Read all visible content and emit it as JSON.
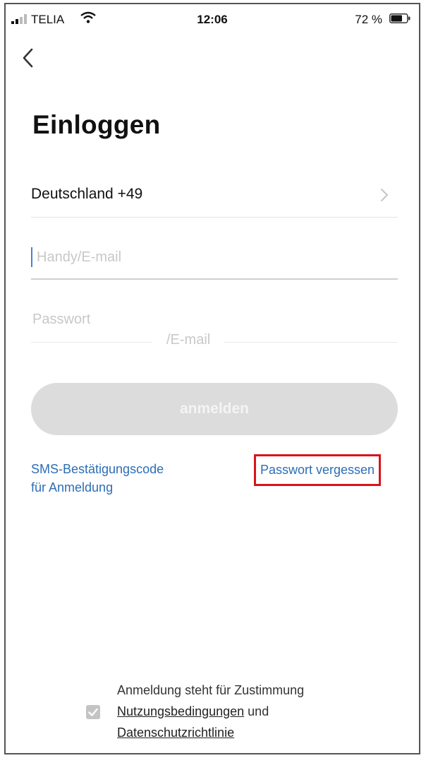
{
  "status_bar": {
    "carrier": "TELIA",
    "time": "12:06",
    "battery_percent": "72 %",
    "battery_level": 0.72
  },
  "nav": {
    "back_icon": "chevron-left-icon"
  },
  "page": {
    "title": "Einloggen"
  },
  "country": {
    "label": "Deutschland +49",
    "chevron_icon": "chevron-right-icon"
  },
  "form": {
    "user_placeholder": "Handy/E-mail",
    "user_value": "",
    "password_placeholder": "Passwort",
    "password_value": "",
    "overlay_text": "/E-mail"
  },
  "actions": {
    "login_label": "anmelden",
    "sms_line1": "SMS-Bestätigungscode",
    "sms_line2": "für Anmeldung",
    "forgot_label": "Passwort vergessen"
  },
  "agreement": {
    "text_line1": "Anmeldung steht für Zustimmung",
    "terms_link": "Nutzungsbedingungen",
    "and_text": "und",
    "privacy_link": "Datenschutzrichtlinie",
    "checked": true
  },
  "colors": {
    "link": "#2c6eb5",
    "highlight_box": "#d8141b",
    "button_disabled": "#dcdcdc",
    "caret": "#4a7fd6"
  }
}
